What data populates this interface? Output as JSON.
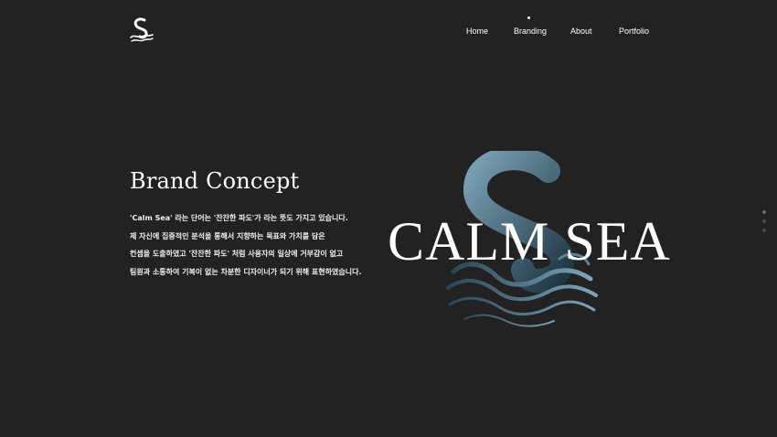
{
  "header": {
    "logo_icon": "calm-sea-wave-logo-icon",
    "nav": [
      {
        "label": "Home",
        "active": false
      },
      {
        "label": "Branding",
        "active": true
      },
      {
        "label": "About",
        "active": false
      },
      {
        "label": "Portfolio",
        "active": false
      }
    ]
  },
  "main": {
    "title": "Brand Concept",
    "description": [
      "'Calm Sea' 라는 단어는 '잔잔한 파도'가 라는 뜻도 가지고 있습니다.",
      "제 자신에 집중적인 분석을 통해서 지향하는 목표와 가치를 담은",
      "컨셉을 도출하였고 '잔잔한 파도' 처럼 사용자의 일상에 거부감이 없고",
      "팀원과 소통하여 기복이 없는 차분한 디자이너가 되기 위해 표현하였습니다."
    ],
    "brand_wordmark": "CALM SEA",
    "brand_emblem_icon": "calm-sea-wave-emblem-icon"
  },
  "pager": {
    "count": 3,
    "active_index": 0
  },
  "colors": {
    "background": "#222223",
    "text": "#ffffff",
    "emblem_light": "#6f96a8",
    "emblem_dark": "#1d3340"
  }
}
